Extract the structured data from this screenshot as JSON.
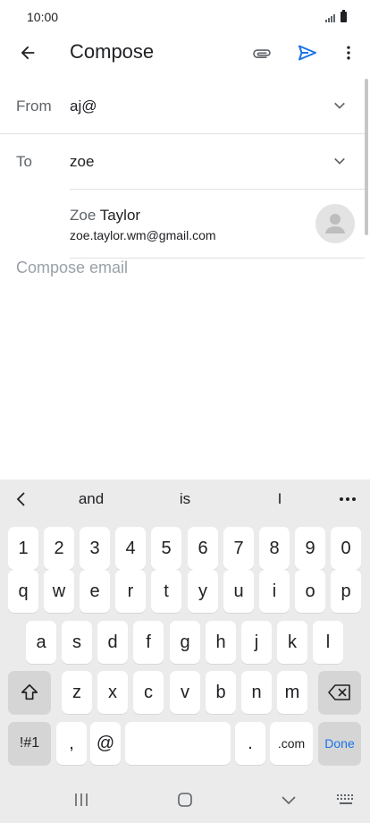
{
  "status_bar": {
    "time": "10:00"
  },
  "app_bar": {
    "title": "Compose"
  },
  "from_field": {
    "label": "From",
    "value": "aj@"
  },
  "to_field": {
    "label": "To",
    "value": "zoe"
  },
  "suggestion": {
    "name_match": "Zoe",
    "name_rest": " Taylor",
    "email": "zoe.taylor.wm@gmail.com"
  },
  "compose": {
    "placeholder": "Compose email"
  },
  "keyboard": {
    "predictions": [
      "and",
      "is",
      "I"
    ],
    "rows": [
      [
        "1",
        "2",
        "3",
        "4",
        "5",
        "6",
        "7",
        "8",
        "9",
        "0"
      ],
      [
        "q",
        "w",
        "e",
        "r",
        "t",
        "y",
        "u",
        "i",
        "o",
        "p"
      ],
      [
        "a",
        "s",
        "d",
        "f",
        "g",
        "h",
        "j",
        "k",
        "l"
      ],
      [
        "z",
        "x",
        "c",
        "v",
        "b",
        "n",
        "m"
      ]
    ],
    "symbols_label": "!#1",
    "comma": ",",
    "at": "@",
    "period": ".",
    "dotcom": ".com",
    "done_label": "Done"
  },
  "colors": {
    "accent": "#1a73e8",
    "keyboard_bg": "#ebebeb",
    "func_key": "#d5d5d5"
  },
  "icons": {
    "back": "arrow-back-icon",
    "attach": "paperclip-icon",
    "send": "send-icon",
    "more": "more-vert-icon",
    "chevron": "chevron-down-icon",
    "avatar": "person-icon",
    "shift": "shift-icon",
    "backspace": "backspace-icon",
    "nav_recents": "recents-icon",
    "nav_home": "home-icon",
    "nav_back": "nav-back-icon",
    "nav_keyboard": "keyboard-icon"
  }
}
